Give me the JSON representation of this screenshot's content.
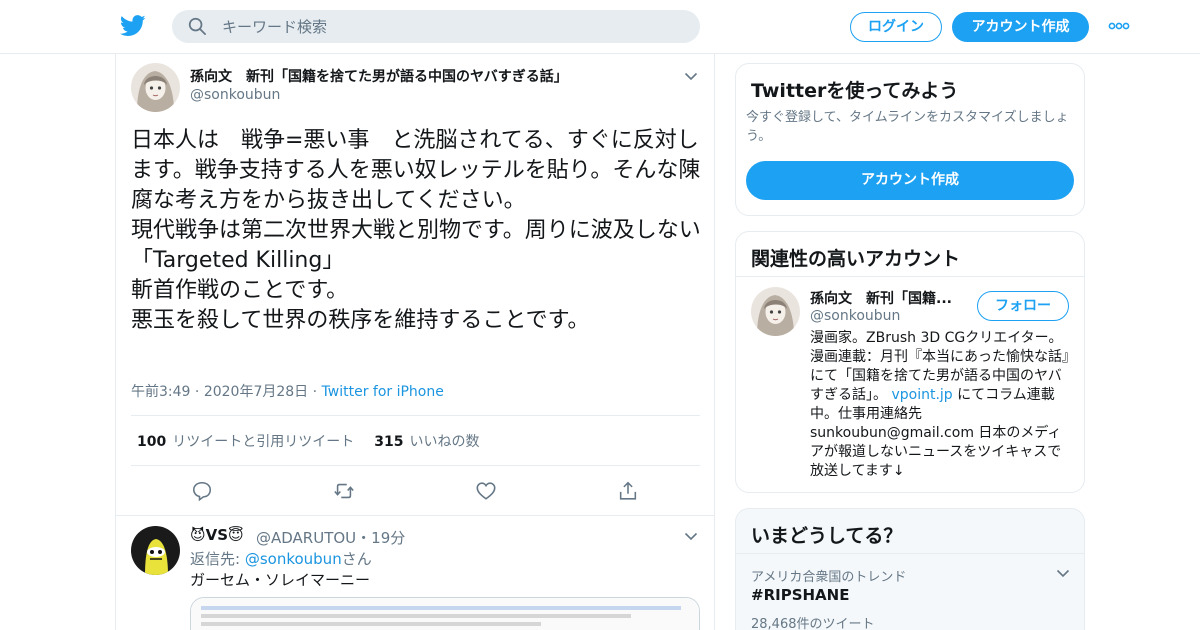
{
  "topbar": {
    "search_placeholder": "キーワード検索",
    "login_label": "ログイン",
    "signup_label": "アカウント作成"
  },
  "tweet": {
    "display_name": "孫向文　新刊「国籍を捨てた男が語る中国のヤバすぎる話」",
    "handle": "@sonkoubun",
    "text": "日本人は　戦争=悪い事　と洗脳されてる、すぐに反対します。戦争支持する人を悪い奴レッテルを貼り。そんな陳腐な考え方をから抜き出してください。\n現代戦争は第二次世界大戦と別物です。周りに波及しない\n「Targeted Killing」\n斬首作戦のことです。\n悪玉を殺して世界の秩序を維持することです。",
    "time": "午前3:49",
    "date": "2020年7月28日",
    "source": "Twitter for iPhone",
    "retweets_count": "100",
    "retweets_label": "リツイートと引用リツイート",
    "likes_count": "315",
    "likes_label": "いいねの数"
  },
  "reply": {
    "display_name": "😈VS😇",
    "handle_time": "@ADARUTOU・19分",
    "reply_prefix": "返信先: ",
    "reply_mention": "@sonkoubun",
    "reply_suffix": "さん",
    "text": "ガーセム・ソレイマーニー"
  },
  "signup_card": {
    "title": "Twitterを使ってみよう",
    "subtitle": "今すぐ登録して、タイムラインをカスタマイズしましょう。",
    "button_label": "アカウント作成"
  },
  "related_card": {
    "title": "関連性の高いアカウント",
    "name": "孫向文　新刊「国籍...",
    "handle": "@sonkoubun",
    "follow_label": "フォロー",
    "bio_part1": "漫画家。ZBrush 3D CGクリエイター。漫画連載：月刊『本当にあった愉快な話』にて「国籍を捨てた男が語る中国のヤバすぎる話」。",
    "bio_link": "vpoint.jp",
    "bio_part2": " にてコラム連載中。仕事用連絡先 sunkoubun@gmail.com 日本のメディアが報道しないニュースをツイキャスで放送してます↓"
  },
  "trends_card": {
    "title": "いまどうしてる？",
    "context": "アメリカ合衆国のトレンド",
    "name": "#RIPSHANE",
    "count": "28,468件のツイート"
  },
  "colors": {
    "accent": "#1da1f2",
    "link": "#1b95e0",
    "secondary_text": "#657786",
    "border": "#e6ecf0"
  }
}
